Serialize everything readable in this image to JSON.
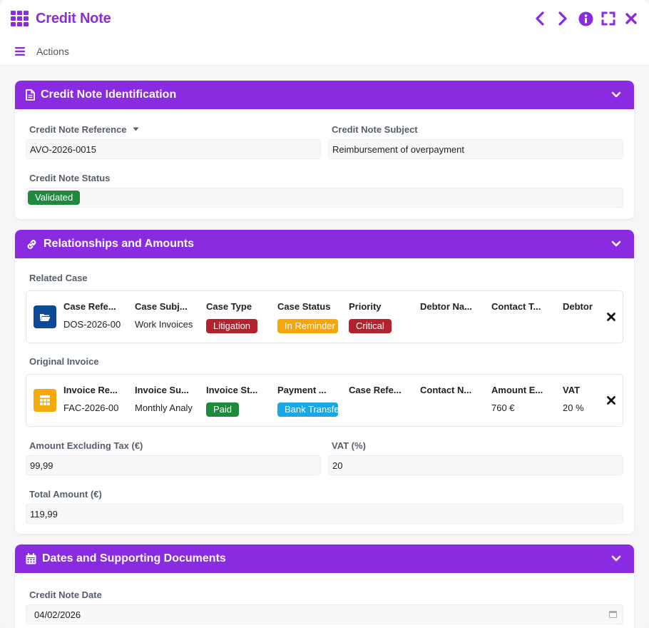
{
  "window": {
    "title": "Credit Note",
    "accent_color": "#8a2be2"
  },
  "actionbar": {
    "actions_label": "Actions"
  },
  "sections": {
    "identification": {
      "title": "Credit Note Identification",
      "fields": {
        "reference_label": "Credit Note Reference",
        "reference_value": "AVO-2026-0015",
        "subject_label": "Credit Note Subject",
        "subject_value": "Reimbursement of overpayment",
        "status_label": "Credit Note Status",
        "status_value": "Validated"
      }
    },
    "relationships": {
      "title": "Relationships and Amounts",
      "related_case": {
        "label": "Related Case",
        "headers": [
          "Case Refe...",
          "Case Subj...",
          "Case Type",
          "Case Status",
          "Priority",
          "Debtor Na...",
          "Contact T...",
          "Debtor"
        ],
        "values": {
          "case_ref": "DOS-2026-00",
          "case_subject": "Work Invoices",
          "case_type": "Litigation",
          "case_status": "In Reminder",
          "priority": "Critical"
        }
      },
      "original_invoice": {
        "label": "Original Invoice",
        "headers": [
          "Invoice Re...",
          "Invoice Su...",
          "Invoice St...",
          "Payment ...",
          "Case Refe...",
          "Contact N...",
          "Amount E...",
          "VAT"
        ],
        "values": {
          "invoice_ref": "FAC-2026-00",
          "invoice_subject": "Monthly Analy",
          "invoice_status": "Paid",
          "payment": "Bank Transfe",
          "amount": "760 €",
          "vat": "20 %"
        }
      },
      "fields": {
        "amount_excl_label": "Amount Excluding Tax (€)",
        "amount_excl_value": "99,99",
        "vat_label": "VAT (%)",
        "vat_value": "20",
        "total_label": "Total Amount (€)",
        "total_value": "119,99"
      }
    },
    "dates": {
      "title": "Dates and Supporting Documents",
      "fields": {
        "date_label": "Credit Note Date",
        "date_value": "04/02/2026"
      }
    }
  }
}
